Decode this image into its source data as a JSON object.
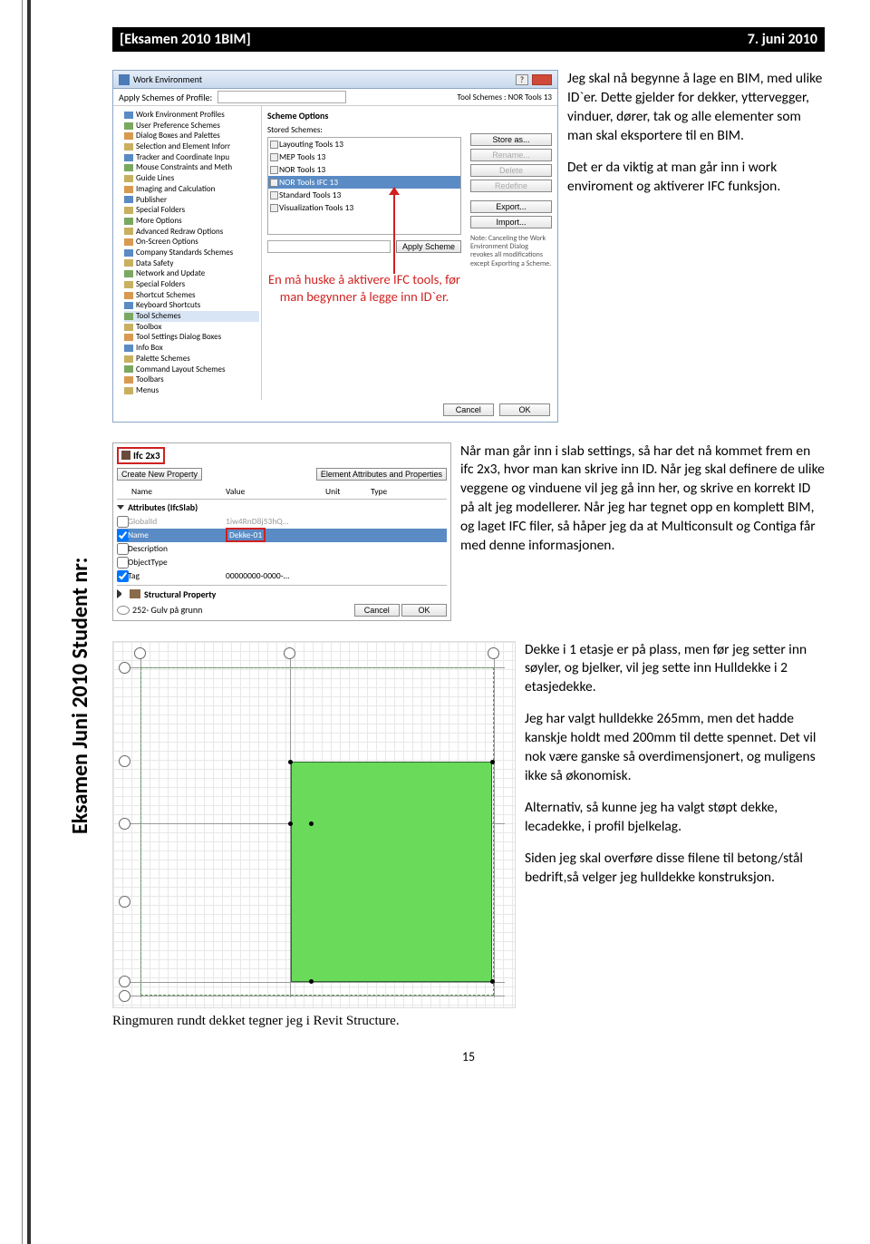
{
  "header": {
    "left": "[Eksamen 2010 1BIM]",
    "right": "7. juni 2010"
  },
  "side_label": "Eksamen Juni 2010 Student nr:",
  "page_number": "15",
  "section1": {
    "p1": "Jeg skal nå begynne å lage en BIM, med ulike ID`er. Dette gjelder for dekker, yttervegger, vinduer, dører, tak og alle elementer som man skal eksportere til en BIM.",
    "p2": "Det er da viktig at man går inn i work enviroment og aktiverer IFC funksjon."
  },
  "win1": {
    "title": "Work Environment",
    "apply_label": "Apply Schemes of Profile:",
    "tree": [
      "Work Environment Profiles",
      "User Preference Schemes",
      "Dialog Boxes and Palettes",
      "Selection and Element Inforr",
      "Tracker and Coordinate Inpu",
      "Mouse Constraints and Meth",
      "Guide Lines",
      "Imaging and Calculation",
      "Publisher",
      "Special Folders",
      "More Options",
      "Advanced Redraw Options",
      "On-Screen Options",
      "Company Standards Schemes",
      "Data Safety",
      "Network and Update",
      "Special Folders",
      "Shortcut Schemes",
      "Keyboard Shortcuts",
      "Tool Schemes",
      "Toolbox",
      "Tool Settings Dialog Boxes",
      "Info Box",
      "Palette Schemes",
      "Command Layout Schemes",
      "Toolbars",
      "Menus"
    ],
    "scheme_options": "Scheme Options",
    "tool_schemes": "Tool Schemes : NOR Tools 13",
    "stored": "Stored Schemes:",
    "list": [
      "Layouting Tools 13",
      "MEP Tools 13",
      "NOR Tools 13",
      "NOR Tools IFC 13",
      "Standard Tools 13",
      "Visualization Tools 13"
    ],
    "apply_scheme": "Apply Scheme",
    "red_note": "En må huske å aktivere IFC tools, før man begynner å legge inn ID`er.",
    "btns": {
      "store": "Store as...",
      "rename": "Rename...",
      "delete": "Delete",
      "redefine": "Redefine",
      "export": "Export...",
      "import": "Import..."
    },
    "note": "Note: Canceling the Work Environment Dialog revokes all modifications except Exporting a Scheme.",
    "cancel": "Cancel",
    "ok": "OK"
  },
  "section2": {
    "p": "Når man går inn i slab settings, så har det nå kommet frem en ifc 2x3, hvor man kan skrive inn ID. Når jeg skal definere de ulike veggene og vinduene vil jeg gå inn her, og skrive en korrekt ID på alt jeg modellerer. Når jeg har tegnet opp en komplett BIM, og laget IFC filer, så håper jeg da at Multiconsult og Contiga får med denne informasjonen."
  },
  "win2": {
    "ifc": "Ifc 2x3",
    "create": "Create New Property",
    "elem": "Element Attributes and Properties",
    "cols": [
      "Name",
      "Value",
      "Unit",
      "Type"
    ],
    "attr_label": "Attributes (IfcSlab)",
    "rows": [
      {
        "name": "GlobalId",
        "value": "1iw4RnD8j53hQ…",
        "sel": false,
        "chk": false,
        "grey": true
      },
      {
        "name": "Name",
        "value": "Dekke-01",
        "sel": true,
        "chk": true
      },
      {
        "name": "Description",
        "value": "",
        "sel": false,
        "chk": false
      },
      {
        "name": "ObjectType",
        "value": "",
        "sel": false,
        "chk": false
      },
      {
        "name": "Tag",
        "value": "00000000-0000-…",
        "sel": false,
        "chk": true
      }
    ],
    "struct": "Structural Property",
    "foot": "252- Gulv på grunn",
    "cancel": "Cancel",
    "ok": "OK"
  },
  "section3": {
    "caption": "Ringmuren rundt dekket tegner jeg i Revit Structure.",
    "p1": "Dekke i 1 etasje er på plass, men før jeg setter inn søyler, og bjelker, vil jeg sette inn Hulldekke i 2 etasjedekke.",
    "p2": "Jeg har valgt hulldekke 265mm, men det hadde kanskje holdt med 200mm til dette spennet. Det vil nok være ganske så overdimensjonert, og muligens ikke så økonomisk.",
    "p3": "Alternativ, så kunne jeg ha valgt støpt dekke, lecadekke, i profil bjelkelag.",
    "p4": "Siden jeg skal overføre disse filene til betong/stål bedrift,så velger jeg hulldekke konstruksjon."
  }
}
